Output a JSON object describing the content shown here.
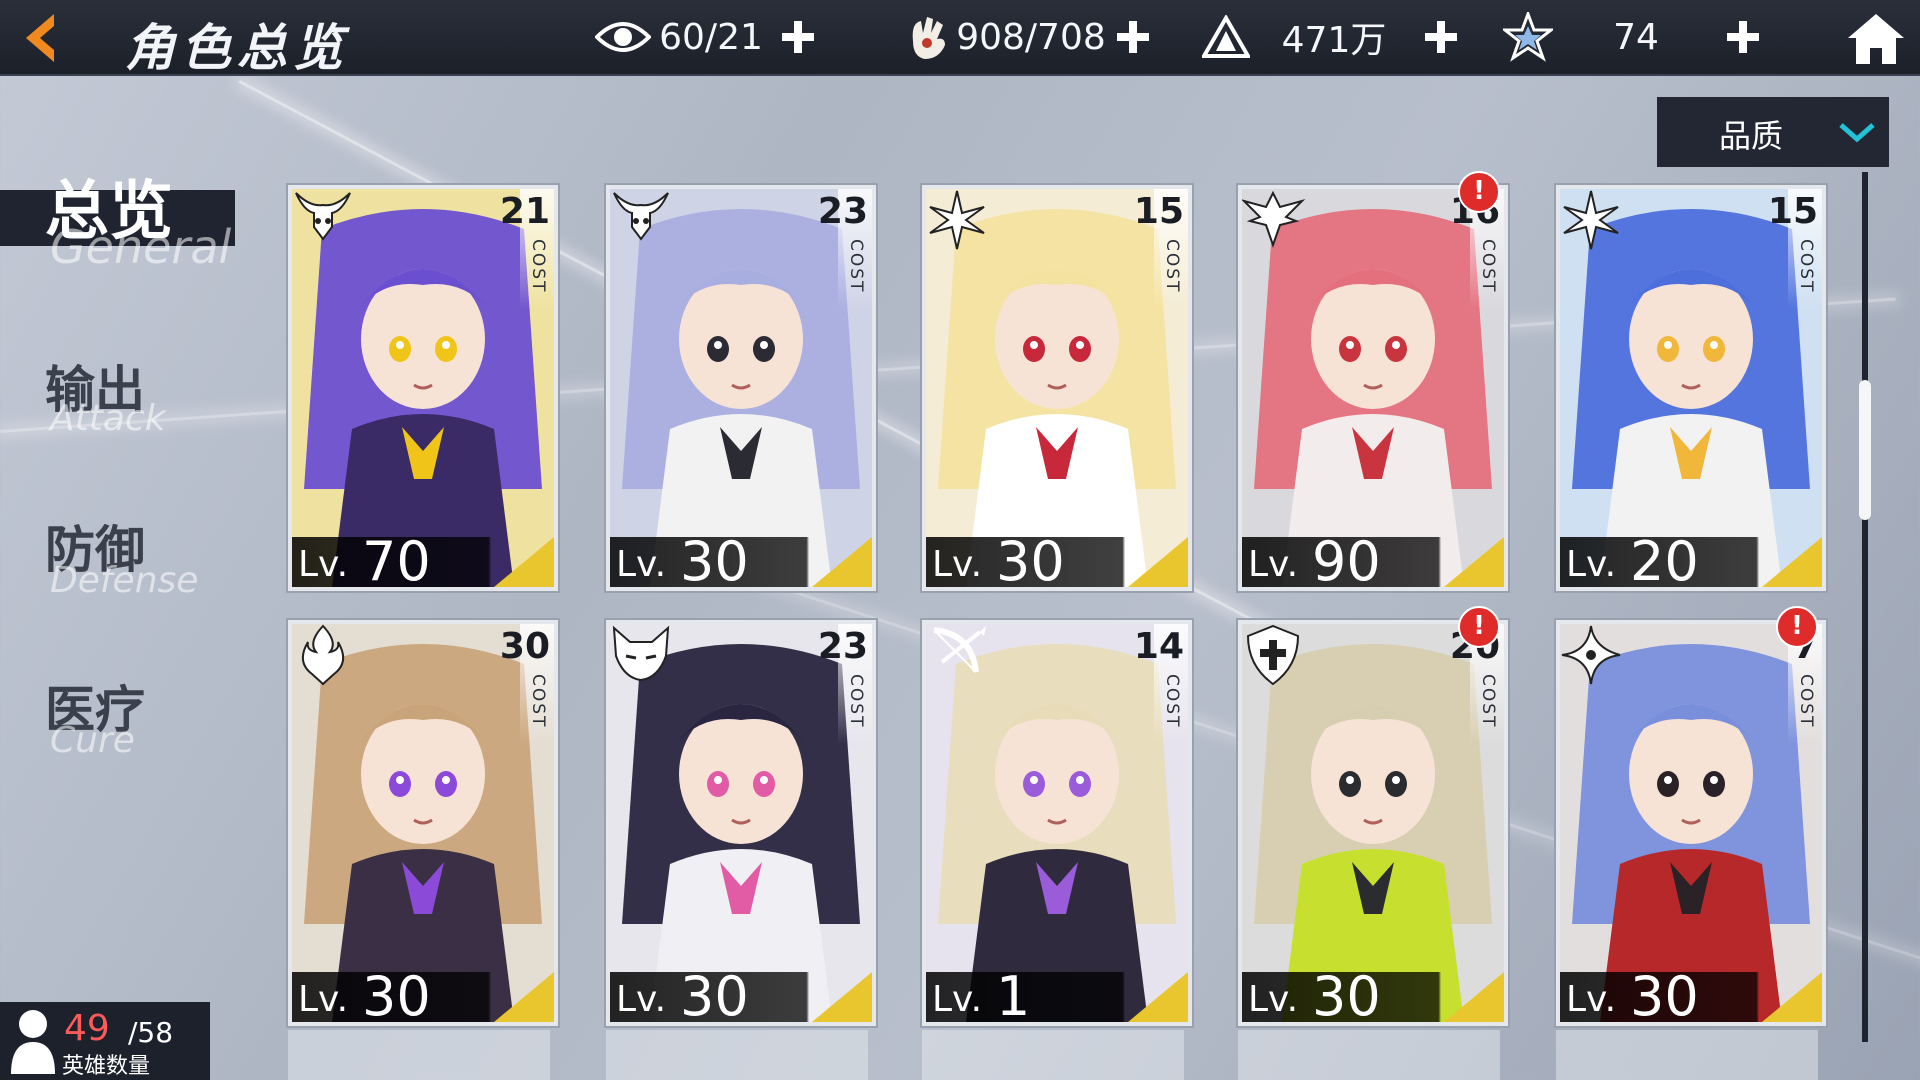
{
  "header": {
    "title": "角色总览",
    "resources": [
      {
        "icon": "eye-icon",
        "value": "60/21"
      },
      {
        "icon": "hand-currency-icon",
        "value": "908/708"
      },
      {
        "icon": "triangle-gold-icon",
        "value": "471万"
      },
      {
        "icon": "star-gem-icon",
        "value": "74"
      }
    ]
  },
  "sidebar": {
    "items": [
      {
        "cn": "总览",
        "en": "General",
        "active": true
      },
      {
        "cn": "输出",
        "en": "Attack",
        "active": false
      },
      {
        "cn": "防御",
        "en": "Defense",
        "active": false
      },
      {
        "cn": "医疗",
        "en": "Cure",
        "active": false
      }
    ]
  },
  "filter": {
    "selected": "品质"
  },
  "cost_label": "COST",
  "lv_label": "Lv.",
  "cards": [
    {
      "cost": "21",
      "level": "70",
      "role": "horned-demon-icon",
      "alert": false,
      "hair": "#6b4fd1",
      "outfit": "#3a2a66",
      "accent": "#f0c419",
      "bg": "#efe2a0"
    },
    {
      "cost": "23",
      "level": "30",
      "role": "horned-demon-icon",
      "alert": false,
      "hair": "#a9aee0",
      "outfit": "#f2f2f2",
      "accent": "#2b2b33",
      "bg": "#cfd3e6"
    },
    {
      "cost": "15",
      "level": "30",
      "role": "snowflake-icon",
      "alert": false,
      "hair": "#f4e3a0",
      "outfit": "#ffffff",
      "accent": "#c7283a",
      "bg": "#f4ecd4"
    },
    {
      "cost": "16",
      "level": "90",
      "role": "eagle-crest-icon",
      "alert": true,
      "hair": "#e5707d",
      "outfit": "#f3ecec",
      "accent": "#c9353f",
      "bg": "#d9d9dd"
    },
    {
      "cost": "15",
      "level": "20",
      "role": "snowflake-icon",
      "alert": false,
      "hair": "#4d6fdc",
      "outfit": "#f2f2f2",
      "accent": "#f0b73a",
      "bg": "#cfe0f2"
    },
    {
      "cost": "30",
      "level": "30",
      "role": "flame-icon",
      "alert": false,
      "hair": "#c9a47a",
      "outfit": "#3b2f45",
      "accent": "#8b4ad8",
      "bg": "#e4ddd2"
    },
    {
      "cost": "23",
      "level": "30",
      "role": "fox-mask-icon",
      "alert": false,
      "hair": "#2a2540",
      "outfit": "#f0f0f4",
      "accent": "#e15ba5",
      "bg": "#e6e6ec"
    },
    {
      "cost": "14",
      "level": "1",
      "role": "bow-icon",
      "alert": false,
      "hair": "#e8dcb8",
      "outfit": "#2f2a3d",
      "accent": "#9a5cd8",
      "bg": "#e6e3ee"
    },
    {
      "cost": "20",
      "level": "30",
      "role": "shield-cross-icon",
      "alert": true,
      "hair": "#d7cdb0",
      "outfit": "#c7e02f",
      "accent": "#2a2c30",
      "bg": "#dcdcdc"
    },
    {
      "cost": "7",
      "level": "30",
      "role": "shuriken-icon",
      "alert": true,
      "hair": "#7a8fdc",
      "outfit": "#b7282a",
      "accent": "#2a2226",
      "bg": "#e3dede"
    }
  ],
  "hero_count": {
    "current": "49",
    "max": "/58",
    "label": "英雄数量"
  },
  "colors": {
    "accent": "#f08a1f",
    "dark_panel": "#1f2430",
    "level_gold": "#e9c62e",
    "alert_red": "#e02b2b"
  }
}
